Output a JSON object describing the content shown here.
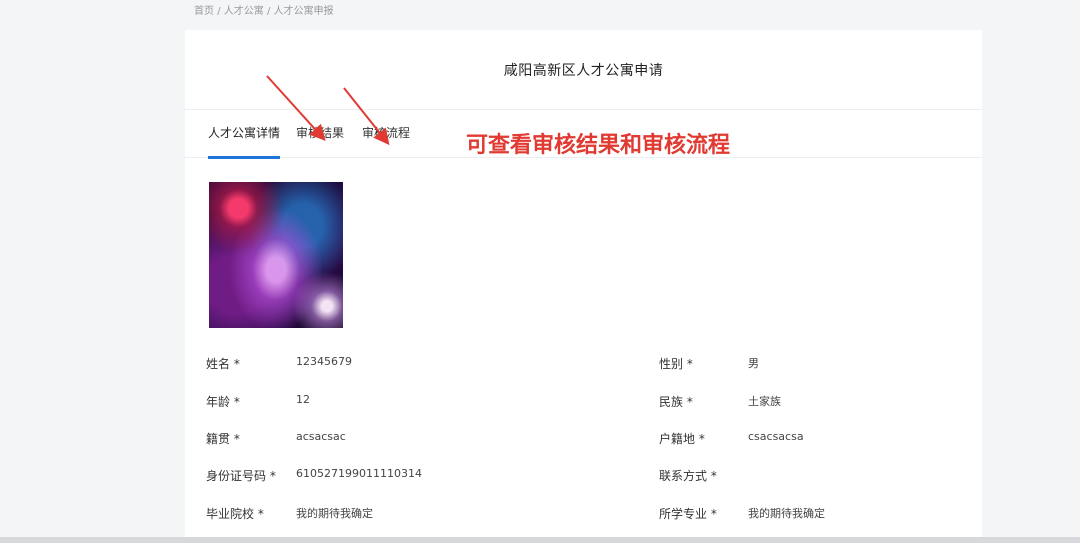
{
  "breadcrumb": {
    "items": [
      "首页",
      "人才公寓",
      "人才公寓申报"
    ],
    "separator": "/"
  },
  "card": {
    "title": "咸阳高新区人才公寓申请"
  },
  "tabs": [
    {
      "label": "人才公寓详情",
      "active": true
    },
    {
      "label": "审核结果",
      "active": false
    },
    {
      "label": "审核流程",
      "active": false
    }
  ],
  "annotation": {
    "text": "可查看审核结果和审核流程",
    "color": "#e03a33"
  },
  "form": {
    "name": {
      "label": "姓名 *",
      "value": "12345679"
    },
    "gender": {
      "label": "性别 *",
      "value": "男"
    },
    "age": {
      "label": "年龄 *",
      "value": "12"
    },
    "ethnicity": {
      "label": "民族 *",
      "value": "土家族"
    },
    "native_place": {
      "label": "籍贯 *",
      "value": "acsacsac"
    },
    "household": {
      "label": "户籍地 *",
      "value": "csacsacsa"
    },
    "id_number": {
      "label": "身份证号码 *",
      "value": "610527199011110314"
    },
    "contact": {
      "label": "联系方式 *",
      "value": ""
    },
    "school": {
      "label": "毕业院校 *",
      "value": "我的期待我确定"
    },
    "major": {
      "label": "所学专业 *",
      "value": "我的期待我确定"
    }
  },
  "colors": {
    "accent": "#1d74d8",
    "annotation": "#e03a33"
  }
}
